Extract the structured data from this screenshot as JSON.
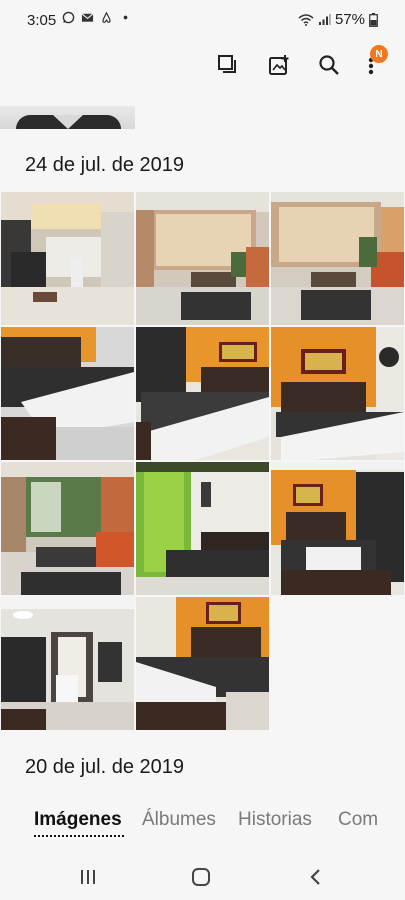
{
  "status": {
    "time": "3:05",
    "battery": "57%",
    "notification_icons": [
      "whatsapp-icon",
      "mail-icon",
      "airbnb-icon",
      "dot-icon"
    ]
  },
  "toolbar": {
    "buttons": [
      "select-icon",
      "add-story-icon",
      "search-icon",
      "more-options-icon"
    ],
    "badge": "N",
    "badge_color": "#f2781f"
  },
  "sections": [
    {
      "date": "24 de jul. de 2019",
      "photo_count": 11
    },
    {
      "date": "20 de jul. de 2019"
    }
  ],
  "tabs": [
    {
      "label": "Imágenes",
      "active": true
    },
    {
      "label": "Álbumes",
      "active": false
    },
    {
      "label": "Historias",
      "active": false
    },
    {
      "label": "Com",
      "active": false
    }
  ],
  "navbar": [
    "recent-apps-icon",
    "home-icon",
    "back-icon"
  ]
}
